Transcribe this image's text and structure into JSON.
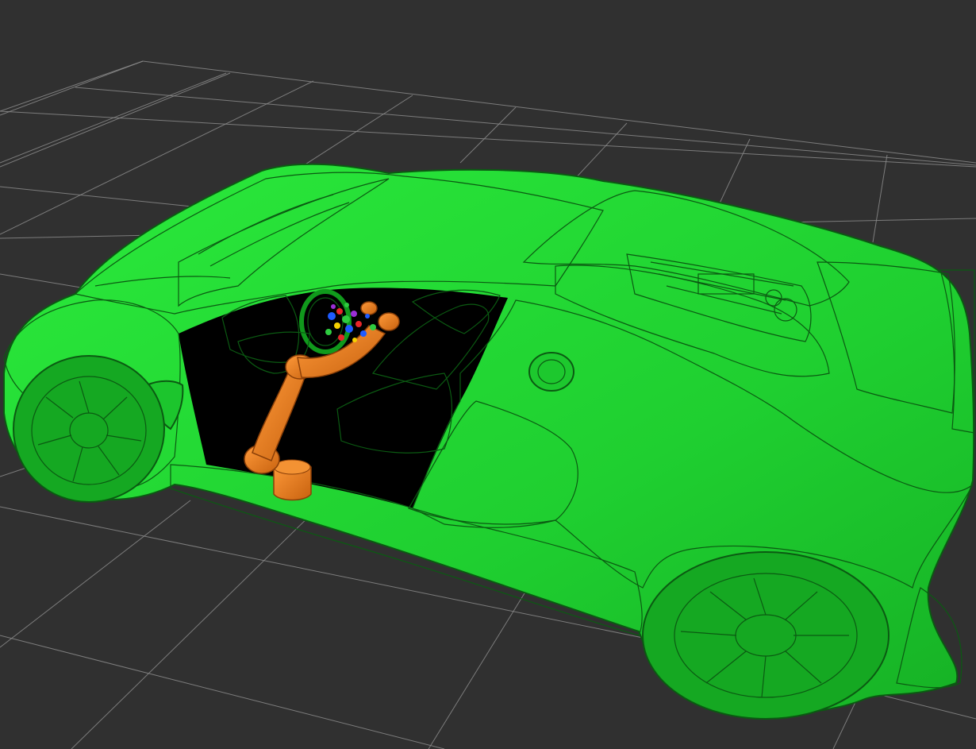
{
  "viewer": {
    "background_color": "#303030",
    "grid_color": "#8a8a8a",
    "grid_visible": true
  },
  "objects": [
    {
      "name": "car-model",
      "color": "#22dd33",
      "shading": "#15a81f"
    },
    {
      "name": "robot-arm",
      "color": "#f07a18",
      "shading": "#b9570c"
    },
    {
      "name": "collision-markers",
      "colors": [
        "#1e5bff",
        "#e6262a",
        "#2ecc40",
        "#f5d000",
        "#9b2fd6"
      ]
    }
  ]
}
